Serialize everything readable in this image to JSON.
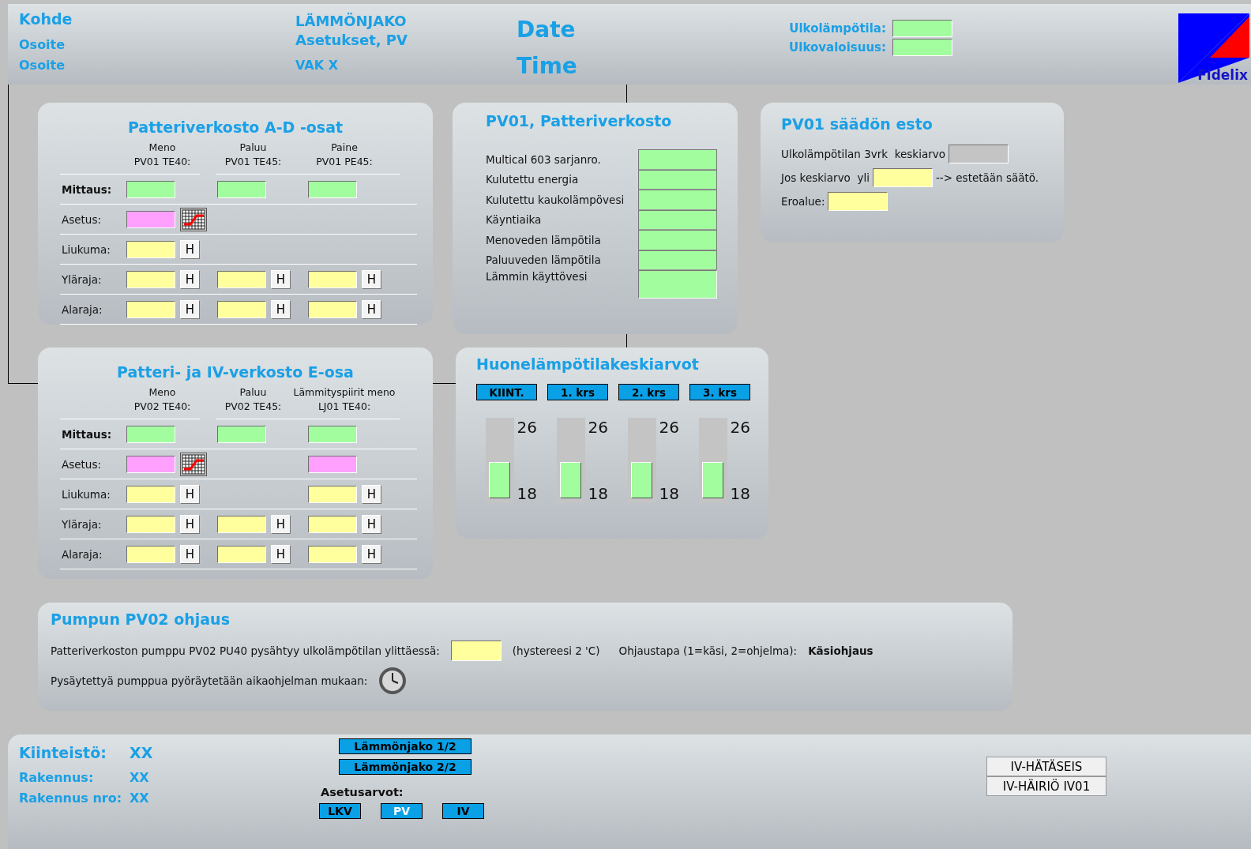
{
  "header": {
    "site": "Kohde",
    "addresses": [
      "Osoite",
      "Osoite"
    ],
    "title_lines": [
      "LÄMMÖNJAKO",
      "Asetukset, PV"
    ],
    "device": "VAK X",
    "date": "Date",
    "time": "Time",
    "outdoor": [
      {
        "label": "Ulkolämpötila:",
        "kind": "measure"
      },
      {
        "label": "Ulkovaloisuus:",
        "kind": "measure"
      }
    ],
    "logo_text": "Fidelix"
  },
  "network_panels": [
    {
      "title": "Patteriverkosto A-D -osat",
      "columns": [
        {
          "line1": "Meno",
          "line2": "PV01 TE40:"
        },
        {
          "line1": "Paluu",
          "line2": "PV01 TE45:"
        },
        {
          "line1": "Paine",
          "line2": "PV01 PE45:"
        }
      ],
      "rows": [
        {
          "label": "Mittaus:",
          "emphasis": true,
          "cells": [
            {
              "kind": "measure"
            },
            {
              "kind": "measure"
            },
            {
              "kind": "measure"
            }
          ]
        },
        {
          "label": "Asetus:",
          "emphasis": false,
          "cells": [
            {
              "kind": "setpoint",
              "curve_button": true
            },
            null,
            null
          ]
        },
        {
          "label": "Liukuma:",
          "emphasis": false,
          "cells": [
            {
              "kind": "param",
              "button": "H"
            },
            null,
            null
          ]
        },
        {
          "label": "Yläraja:",
          "emphasis": false,
          "cells": [
            {
              "kind": "param",
              "button": "H"
            },
            {
              "kind": "param",
              "button": "H"
            },
            {
              "kind": "param",
              "button": "H"
            }
          ]
        },
        {
          "label": "Alaraja:",
          "emphasis": false,
          "cells": [
            {
              "kind": "param",
              "button": "H"
            },
            {
              "kind": "param",
              "button": "H"
            },
            {
              "kind": "param",
              "button": "H"
            }
          ]
        }
      ]
    },
    {
      "title": "Patteri- ja IV-verkosto E-osa",
      "columns": [
        {
          "line1": "Meno",
          "line2": "PV02 TE40:"
        },
        {
          "line1": "Paluu",
          "line2": "PV02 TE45:"
        },
        {
          "line1": "Lämmityspiirit meno",
          "line2": "LJ01 TE40:"
        }
      ],
      "rows": [
        {
          "label": "Mittaus:",
          "emphasis": true,
          "cells": [
            {
              "kind": "measure"
            },
            {
              "kind": "measure"
            },
            {
              "kind": "measure"
            }
          ]
        },
        {
          "label": "Asetus:",
          "emphasis": false,
          "cells": [
            {
              "kind": "setpoint",
              "curve_button": true
            },
            null,
            {
              "kind": "setpoint"
            }
          ]
        },
        {
          "label": "Liukuma:",
          "emphasis": false,
          "cells": [
            {
              "kind": "param",
              "button": "H"
            },
            null,
            {
              "kind": "param",
              "button": "H"
            }
          ]
        },
        {
          "label": "Yläraja:",
          "emphasis": false,
          "cells": [
            {
              "kind": "param",
              "button": "H"
            },
            {
              "kind": "param",
              "button": "H"
            },
            {
              "kind": "param",
              "button": "H"
            }
          ]
        },
        {
          "label": "Alaraja:",
          "emphasis": false,
          "cells": [
            {
              "kind": "param",
              "button": "H"
            },
            {
              "kind": "param",
              "button": "H"
            },
            {
              "kind": "param",
              "button": "H"
            }
          ]
        }
      ]
    }
  ],
  "meter_panel": {
    "title": "PV01, Patteriverkosto",
    "rows": [
      {
        "label": "Multical 603 sarjanro.",
        "kind": "measure"
      },
      {
        "label": "Kulutettu energia",
        "kind": "measure"
      },
      {
        "label": "Kulutettu kaukolämpövesi",
        "kind": "measure"
      },
      {
        "label": "Käyntiaika",
        "kind": "measure"
      },
      {
        "label": "Menoveden lämpötila",
        "kind": "measure"
      },
      {
        "label": "Paluuveden lämpötila",
        "kind": "measure"
      },
      {
        "label": "Lämmin käyttövesi",
        "kind": "measure"
      }
    ]
  },
  "block_panel": {
    "title": "PV01 säädön esto",
    "rows": [
      {
        "label": "Ulkolämpötilan 3vrk  keskiarvo",
        "kind": "readonly"
      },
      {
        "label": "Jos keskiarvo  yli",
        "kind": "param",
        "suffix": "--> estetään säätö."
      },
      {
        "label": "Eroalue:",
        "kind": "param"
      }
    ]
  },
  "room_panel": {
    "title": "Huonelämpötilakeskiarvot",
    "zones": [
      {
        "label": "KIINT.",
        "max": "26",
        "min": "18",
        "level": 0.45
      },
      {
        "label": "1. krs",
        "max": "26",
        "min": "18",
        "level": 0.45
      },
      {
        "label": "2. krs",
        "max": "26",
        "min": "18",
        "level": 0.45
      },
      {
        "label": "3. krs",
        "max": "26",
        "min": "18",
        "level": 0.45
      }
    ]
  },
  "pump_panel": {
    "title": "Pumpun PV02 ohjaus",
    "stop_text": "Patteriverkoston pumppu PV02 PU40 pysähtyy ulkolämpötilan ylittäessä:",
    "stop_field": {
      "kind": "param"
    },
    "hysteresis": "(hystereesi 2 'C)",
    "mode_label": "Ohjaustapa (1=käsi, 2=ohjelma):",
    "mode_value": "Käsiohjaus",
    "exercise_text": "Pysäytettyä pumppua pyöräytetään aikaohjelman mukaan:"
  },
  "footer": {
    "info": [
      {
        "label": "Kiinteistö:",
        "value": "XX"
      },
      {
        "label": "Rakennus:",
        "value": "XX"
      },
      {
        "label": "Rakennus nro:",
        "value": "XX"
      }
    ],
    "nav_buttons": [
      "Lämmönjako 1/2",
      "Lämmönjako 2/2"
    ],
    "settings_label": "Asetusarvot:",
    "settings_buttons": [
      {
        "label": "LKV",
        "selected": false
      },
      {
        "label": "PV",
        "selected": true
      },
      {
        "label": "IV",
        "selected": false
      }
    ],
    "alarm_buttons": [
      "IV-HÄTÄSEIS",
      "IV-HÄIRIÖ IV01"
    ]
  }
}
